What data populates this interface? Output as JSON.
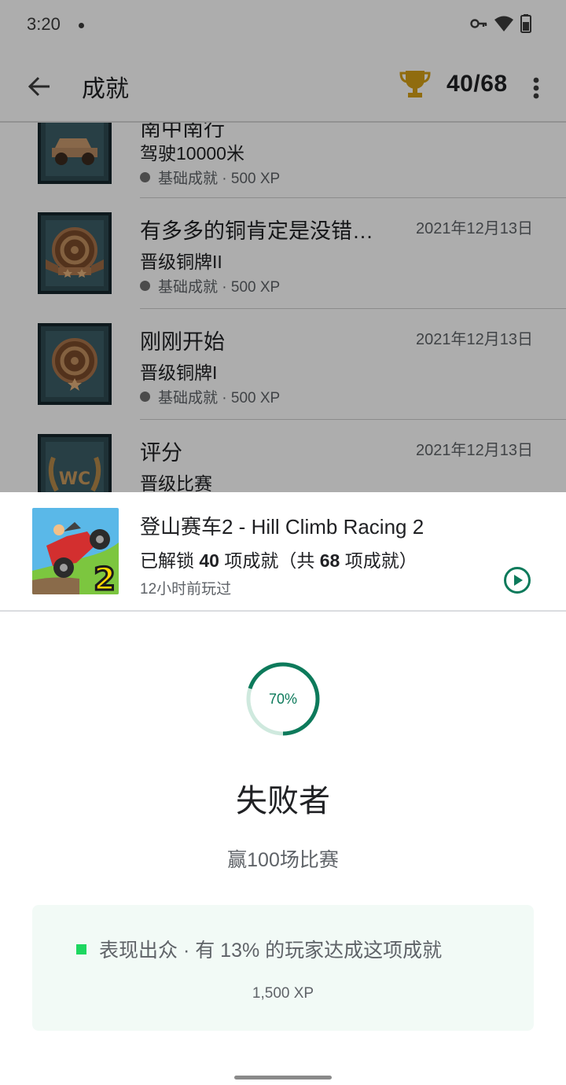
{
  "status_bar": {
    "time": "3:20"
  },
  "app_bar": {
    "title": "成就",
    "count": "40/68",
    "trophy_color": "#d4a017"
  },
  "achievement_list": [
    {
      "title": "南中南行",
      "subtitle": "驾驶10000米",
      "meta": "基础成就 · 500 XP",
      "date": ""
    },
    {
      "title": "有多多的铜肯定是没错…",
      "subtitle": "晋级铜牌II",
      "meta": "基础成就 · 500 XP",
      "date": "2021年12月13日"
    },
    {
      "title": "刚刚开始",
      "subtitle": "晋级铜牌I",
      "meta": "基础成就 · 500 XP",
      "date": "2021年12月13日"
    },
    {
      "title": "评分",
      "subtitle": "晋级比赛",
      "meta": "",
      "date": "2021年12月13日"
    }
  ],
  "badge_text": {
    "wc": "WC"
  },
  "game": {
    "title": "登山赛车2 - Hill Climb Racing 2",
    "progress_prefix": "已解锁",
    "progress_unlocked": "40",
    "progress_mid": "项成就（共",
    "progress_total": "68",
    "progress_suffix": "项成就）",
    "last_played": "12小时前玩过",
    "icon_number": "2"
  },
  "achievement_detail": {
    "progress_label": "70%",
    "progress_fraction": 0.7,
    "name": "失败者",
    "description": "赢100场比赛",
    "rarity_text": "表现出众 · 有 13% 的玩家达成这项成就",
    "xp": "1,500 XP"
  },
  "colors": {
    "accent": "#0d7a5b",
    "ring_track": "#cfe9de",
    "rarity": "#1ed760",
    "card_bg": "#f2faf6"
  }
}
